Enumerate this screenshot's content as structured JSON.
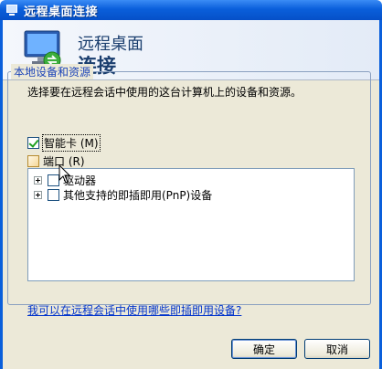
{
  "window": {
    "title": "远程桌面连接"
  },
  "banner": {
    "line1": "远程桌面",
    "line2": "连接"
  },
  "group": {
    "label": "本地设备和资源",
    "description": "选择要在远程会话中使用的这台计算机上的设备和资源。"
  },
  "options": {
    "smart_card": {
      "label": "智能卡 (M)",
      "checked": true
    },
    "ports": {
      "label": "端口 (R)",
      "checked": false
    }
  },
  "tree": {
    "items": [
      {
        "label": "驱动器",
        "checked": false
      },
      {
        "label": "其他支持的即插即用(PnP)设备",
        "checked": false
      }
    ]
  },
  "help_link": "我可以在远程会话中使用哪些即插即用设备?",
  "buttons": {
    "ok": "确定",
    "cancel": "取消"
  },
  "icons": {
    "app": "remote-desktop-icon",
    "banner": "monitor-connection-icon"
  },
  "colors": {
    "titlebar": "#0a5fdb",
    "group_label": "#1c44b8",
    "link": "#0033cc",
    "check": "#21a121"
  }
}
